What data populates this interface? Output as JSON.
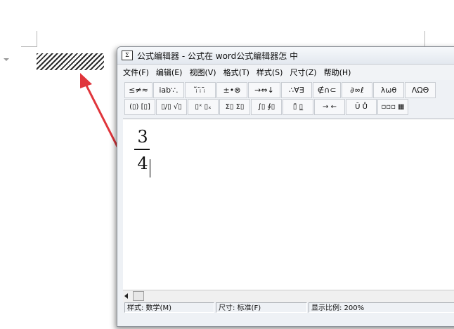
{
  "window": {
    "title": "公式编辑器 - 公式在 word公式编辑器怎 中",
    "icon": "equation-editor-app-icon"
  },
  "menu": [
    {
      "label": "文件(F)"
    },
    {
      "label": "编辑(E)"
    },
    {
      "label": "视图(V)"
    },
    {
      "label": "格式(T)"
    },
    {
      "label": "样式(S)"
    },
    {
      "label": "尺寸(Z)"
    },
    {
      "label": "帮助(H)"
    }
  ],
  "toolbar_row1": [
    {
      "label": "≤≠≈",
      "icon": "relational-symbols-icon"
    },
    {
      "label": "ⅰab∵.",
      "icon": "spaces-ellipses-icon"
    },
    {
      "label": "ᵢ̃ ᵢ̈ ᵢ̄",
      "icon": "embellishments-icon"
    },
    {
      "label": "±•⊗",
      "icon": "operator-symbols-icon"
    },
    {
      "label": "→⇔↓",
      "icon": "arrow-symbols-icon"
    },
    {
      "label": "∴∀∃",
      "icon": "logical-symbols-icon"
    },
    {
      "label": "∉∩⊂",
      "icon": "set-theory-symbols-icon"
    },
    {
      "label": "∂∞ℓ",
      "icon": "misc-symbols-icon"
    },
    {
      "label": "λωθ",
      "icon": "greek-lowercase-icon"
    },
    {
      "label": "ΛΩΘ",
      "icon": "greek-uppercase-icon"
    }
  ],
  "toolbar_row2": [
    {
      "label": "(▯) [▯]",
      "icon": "fence-templates-icon"
    },
    {
      "label": "▯/▯ √▯",
      "icon": "fraction-radical-templates-icon"
    },
    {
      "label": "▯ˣ ▯ₓ",
      "icon": "subscript-superscript-templates-icon"
    },
    {
      "label": "Σ▯ Σ▯",
      "icon": "summation-templates-icon"
    },
    {
      "label": "∫▯ ∮▯",
      "icon": "integral-templates-icon"
    },
    {
      "label": "▯̄ ▯̲",
      "icon": "underbar-overbar-templates-icon"
    },
    {
      "label": "→ ←",
      "icon": "labeled-arrow-templates-icon"
    },
    {
      "label": "Ū Ů",
      "icon": "products-set-theory-templates-icon"
    },
    {
      "label": "▫▫▫ ▦",
      "icon": "matrix-templates-icon"
    }
  ],
  "equation": {
    "numerator": "3",
    "denominator": "4"
  },
  "status": {
    "style": "样式: 数学(M)",
    "size": "尺寸: 标准(F)",
    "zoom": "显示比例: 200%"
  },
  "colors": {
    "arrow": "#e0353b",
    "window_border": "#8a8f96"
  }
}
